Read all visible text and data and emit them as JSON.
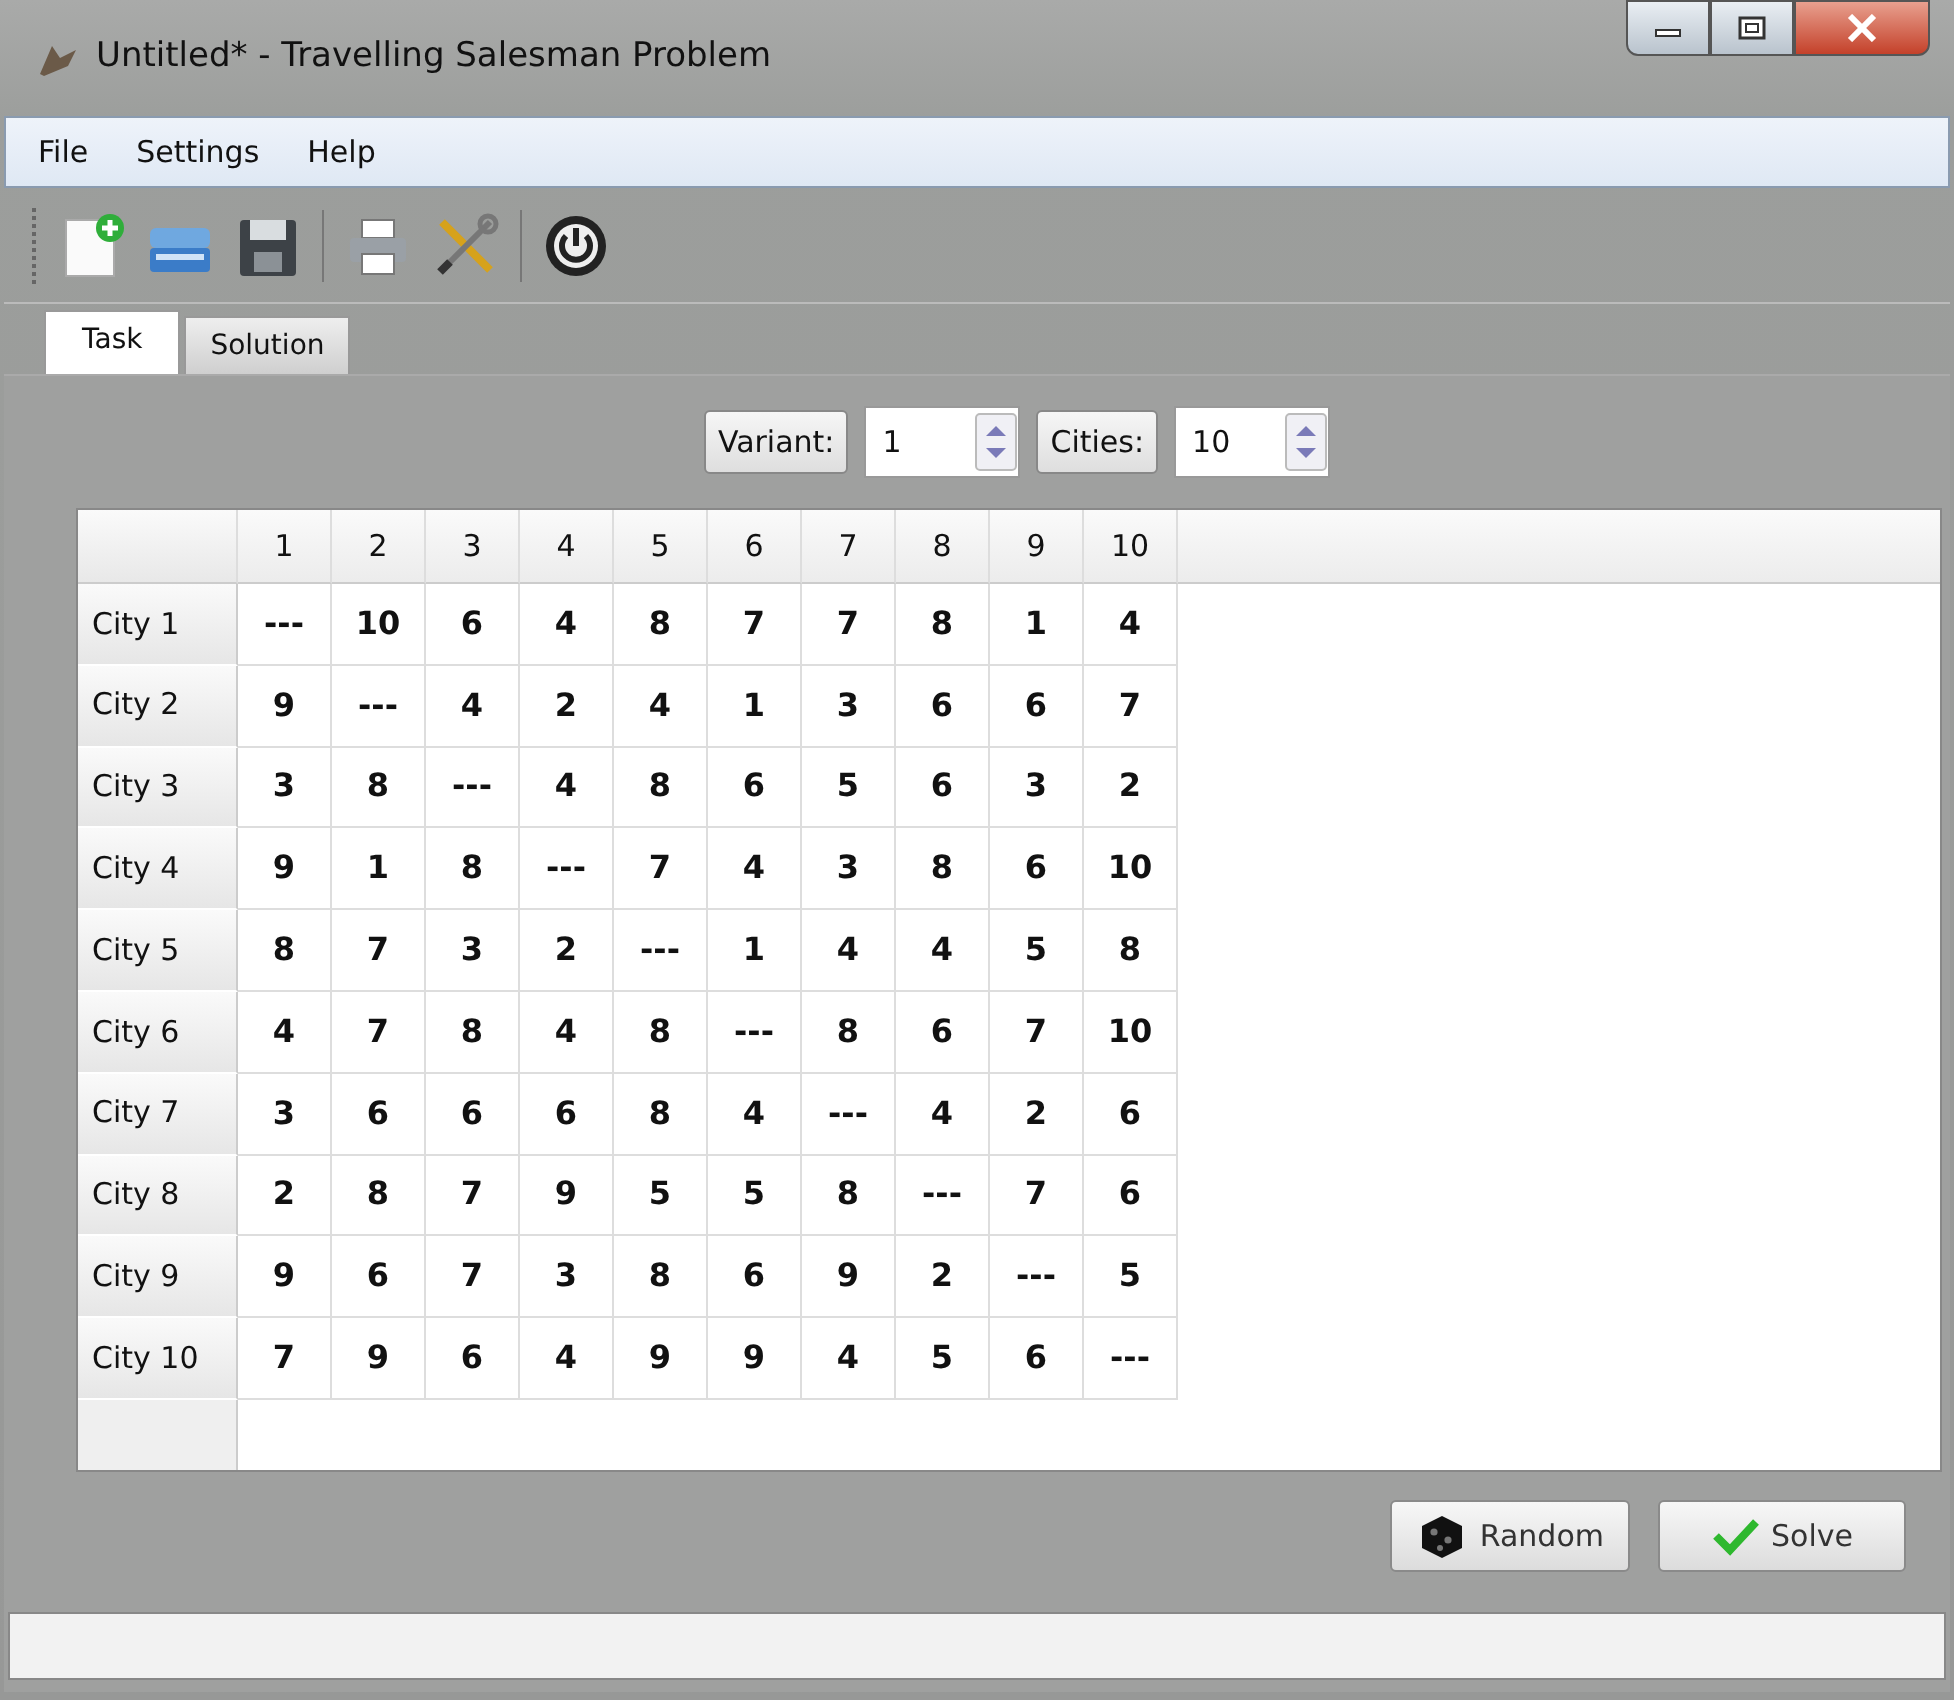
{
  "window": {
    "title": "Untitled* - Travelling Salesman Problem"
  },
  "menu": [
    "File",
    "Settings",
    "Help"
  ],
  "tabs": [
    {
      "label": "Task",
      "selected": true
    },
    {
      "label": "Solution",
      "selected": false
    }
  ],
  "controls": [
    {
      "label": "Variant:",
      "value": "1"
    },
    {
      "label": "Cities:",
      "value": "10"
    }
  ],
  "table": {
    "columns": [
      "1",
      "2",
      "3",
      "4",
      "5",
      "6",
      "7",
      "8",
      "9",
      "10"
    ],
    "rows": [
      {
        "header": "City 1",
        "cells": [
          "---",
          "10",
          "6",
          "4",
          "8",
          "7",
          "7",
          "8",
          "1",
          "4"
        ]
      },
      {
        "header": "City 2",
        "cells": [
          "9",
          "---",
          "4",
          "2",
          "4",
          "1",
          "3",
          "6",
          "6",
          "7"
        ]
      },
      {
        "header": "City 3",
        "cells": [
          "3",
          "8",
          "---",
          "4",
          "8",
          "6",
          "5",
          "6",
          "3",
          "2"
        ]
      },
      {
        "header": "City 4",
        "cells": [
          "9",
          "1",
          "8",
          "---",
          "7",
          "4",
          "3",
          "8",
          "6",
          "10"
        ]
      },
      {
        "header": "City 5",
        "cells": [
          "8",
          "7",
          "3",
          "2",
          "---",
          "1",
          "4",
          "4",
          "5",
          "8"
        ]
      },
      {
        "header": "City 6",
        "cells": [
          "4",
          "7",
          "8",
          "4",
          "8",
          "---",
          "8",
          "6",
          "7",
          "10"
        ]
      },
      {
        "header": "City 7",
        "cells": [
          "3",
          "6",
          "6",
          "6",
          "8",
          "4",
          "---",
          "4",
          "2",
          "6"
        ]
      },
      {
        "header": "City 8",
        "cells": [
          "2",
          "8",
          "7",
          "9",
          "5",
          "5",
          "8",
          "---",
          "7",
          "6"
        ]
      },
      {
        "header": "City 9",
        "cells": [
          "9",
          "6",
          "7",
          "3",
          "8",
          "6",
          "9",
          "2",
          "---",
          "5"
        ]
      },
      {
        "header": "City 10",
        "cells": [
          "7",
          "9",
          "6",
          "4",
          "9",
          "9",
          "4",
          "5",
          "6",
          "---"
        ]
      }
    ]
  },
  "buttons": [
    {
      "kind": "random",
      "label": "Random"
    },
    {
      "kind": "solve",
      "label": "Solve"
    }
  ]
}
